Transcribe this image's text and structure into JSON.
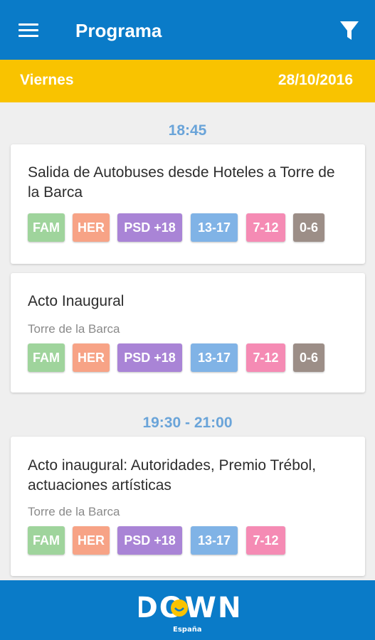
{
  "header": {
    "title": "Programa",
    "menu_icon": "hamburger-menu-icon",
    "filter_icon": "filter-funnel-icon",
    "background": "#0a7bc8"
  },
  "day_bar": {
    "day": "Viernes",
    "date": "28/10/2016",
    "background": "#f9c300"
  },
  "tag_colors": {
    "FAM": "#9fd49c",
    "HER": "#f7a386",
    "PSD +18": "#a984d6",
    "13-17": "#80b3e6",
    "7-12": "#f58bb4",
    "0-6": "#9c8e87"
  },
  "program": [
    {
      "time": "18:45",
      "events": [
        {
          "title": "Salida de Autobuses desde Hoteles a Torre de la Barca",
          "location": "",
          "tags": [
            "FAM",
            "HER",
            "PSD +18",
            "13-17",
            "7-12",
            "0-6"
          ]
        },
        {
          "title": "Acto Inaugural",
          "location": "Torre de la Barca",
          "tags": [
            "FAM",
            "HER",
            "PSD +18",
            "13-17",
            "7-12",
            "0-6"
          ]
        }
      ]
    },
    {
      "time": "19:30 - 21:00",
      "events": [
        {
          "title": "Acto inaugural: Autoridades, Premio Trébol, actuaciones artísticas",
          "location": "Torre de la Barca",
          "tags": [
            "FAM",
            "HER",
            "PSD +18",
            "13-17",
            "7-12"
          ]
        }
      ]
    }
  ],
  "footer": {
    "logo_text": "DOWN",
    "logo_subtext": "España",
    "logo_icon": "down-espana-logo-icon",
    "background": "#0a7bc8"
  }
}
